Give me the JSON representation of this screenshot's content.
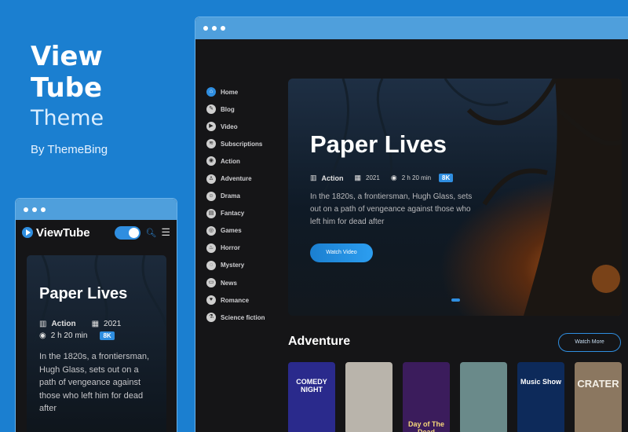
{
  "brand": {
    "line1": "View",
    "line2": "Tube",
    "line3": "Theme",
    "byline": "By ThemeBing"
  },
  "desktop": {
    "nav": [
      {
        "label": "Home",
        "icon": "home-icon",
        "glyph": "⌂",
        "active": true
      },
      {
        "label": "Blog",
        "icon": "blog-icon",
        "glyph": "✎"
      },
      {
        "label": "Video",
        "icon": "video-icon",
        "glyph": "▶"
      },
      {
        "label": "Subscriptions",
        "icon": "rss-icon",
        "glyph": "≋"
      },
      {
        "label": "Action",
        "icon": "camera-icon",
        "glyph": "◉"
      },
      {
        "label": "Adventure",
        "icon": "person-icon",
        "glyph": "♙"
      },
      {
        "label": "Drama",
        "icon": "drama-icon",
        "glyph": "☺"
      },
      {
        "label": "Fantacy",
        "icon": "film-icon",
        "glyph": "▤"
      },
      {
        "label": "Games",
        "icon": "gamepad-icon",
        "glyph": "◎"
      },
      {
        "label": "Horror",
        "icon": "flame-icon",
        "glyph": "♨"
      },
      {
        "label": "Mystery",
        "icon": "globe-icon",
        "glyph": "◌"
      },
      {
        "label": "News",
        "icon": "news-icon",
        "glyph": "▭"
      },
      {
        "label": "Romance",
        "icon": "heart-icon",
        "glyph": "♥"
      },
      {
        "label": "Science fiction",
        "icon": "flask-icon",
        "glyph": "⚗"
      }
    ],
    "hero": {
      "title": "Paper Lives",
      "genre": "Action",
      "year": "2021",
      "duration": "2 h 20 min",
      "quality": "8K",
      "description": "In the 1820s, a frontiersman, Hugh Glass, sets out on a path of vengeance against those who left him for dead after",
      "button": "Watch Video"
    },
    "section": {
      "title": "Adventure",
      "more": "Watch More"
    },
    "posters": [
      {
        "name": "comedy-night",
        "text": "COMEDY NIGHT",
        "bg": "#2a2a8c",
        "fg": "#ffffff"
      },
      {
        "name": "astronaut",
        "text": "",
        "bg": "#b9b4ab",
        "fg": "#333333"
      },
      {
        "name": "day-of-the-dead",
        "text": "Day of The Dead",
        "bg": "#3b1c5c",
        "fg": "#f6d77a"
      },
      {
        "name": "vintage-car",
        "text": "",
        "bg": "#6a8a8a",
        "fg": "#ffffff"
      },
      {
        "name": "music-show",
        "text": "Music Show",
        "bg": "#0d2a5a",
        "fg": "#ffffff"
      },
      {
        "name": "crater",
        "text": "CRATER",
        "bg": "#8b7760",
        "fg": "#f3efe6"
      }
    ]
  },
  "mobile": {
    "logo": "ViewTube",
    "hero": {
      "title": "Paper Lives",
      "genre": "Action",
      "year": "2021",
      "duration": "2 h 20 min",
      "quality": "8K",
      "description": "In the 1820s, a frontiersman, Hugh Glass, sets out on a path of vengeance against those who left him for dead after"
    }
  },
  "colors": {
    "accent": "#2f8ee0",
    "background": "#1b7fd0",
    "window": "#151517"
  }
}
